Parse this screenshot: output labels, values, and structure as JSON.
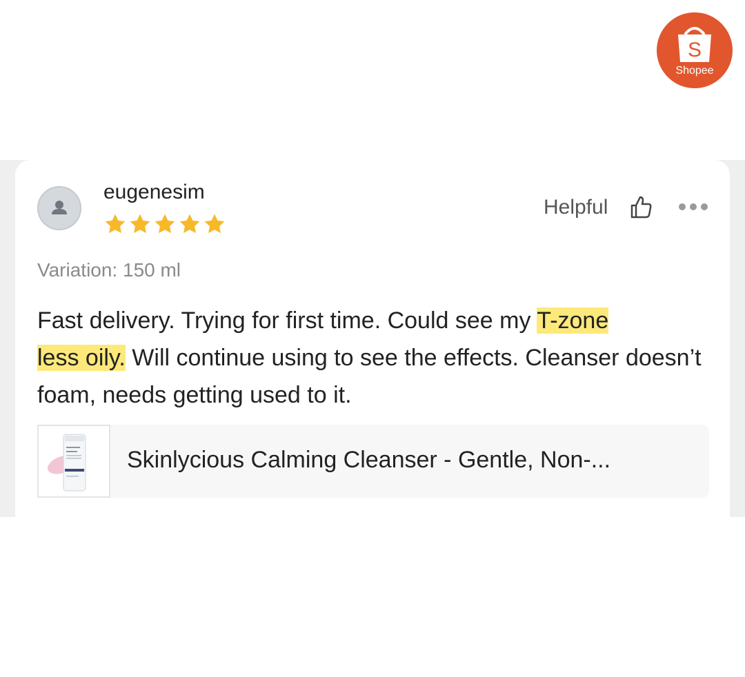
{
  "brand": {
    "name": "Shopee",
    "logo_letter": "S",
    "color": "#e1562d"
  },
  "review": {
    "username": "eugenesim",
    "rating": 5,
    "rating_max": 5,
    "helpful_label": "Helpful",
    "variation": "Variation: 150 ml",
    "text_before": "Fast delivery. Trying for first time. Could see my ",
    "text_highlight_1": "T-zone",
    "text_highlight_2": "less oily.",
    "text_after": " Will continue using to see the effects. Cleanser doesn’t foam, needs getting used to it.",
    "highlight_color": "#fde97a",
    "star_color": "#f7b928"
  },
  "product": {
    "name": "Skinlycious Calming Cleanser - Gentle, Non-...",
    "thumb_brand": "SkinSerious"
  },
  "icons": {
    "avatar": "user-avatar-icon",
    "helpful": "thumbs-up-icon",
    "more": "more-dots-icon"
  }
}
